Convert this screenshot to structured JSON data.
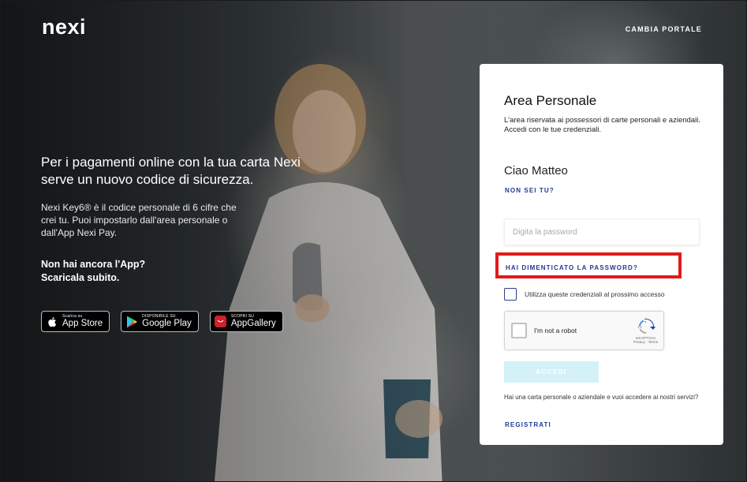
{
  "header": {
    "logo_text": "nexi",
    "change_portal": "CAMBIA PORTALE"
  },
  "hero": {
    "headline": "Per i pagamenti online con la tua carta Nexi serve un nuovo codice di sicurezza.",
    "body": "Nexi Key6® è il codice personale di 6 cifre che crei tu. Puoi impostarlo dall'area personale o dall'App Nexi Pay.",
    "cta_line1": "Non hai ancora l'App?",
    "cta_line2": "Scaricala subito."
  },
  "stores": [
    {
      "small": "Scarica su",
      "big": "App Store",
      "icon": "apple-icon"
    },
    {
      "small": "DISPONIBILE SU",
      "big": "Google Play",
      "icon": "google-play-icon"
    },
    {
      "small": "SCOPRI SU",
      "big": "AppGallery",
      "icon": "huawei-icon"
    }
  ],
  "login": {
    "title": "Area Personale",
    "description": "L'area riservata ai possessori di carte personali e aziendali. Accedi con le tue credenziali.",
    "greeting": "Ciao Matteo",
    "not_you": "NON SEI TU?",
    "password_placeholder": "Digita la password",
    "forgot_password": "HAI DIMENTICATO LA PASSWORD?",
    "remember_label": "Utilizza queste credenziali al prossimo accesso",
    "captcha_label": "I'm not a robot",
    "captcha_brand": "reCAPTCHA",
    "captcha_links": "Privacy - Terms",
    "submit": "ACCEDI",
    "register_prompt": "Hai una carta personale o aziendale e vuoi accedere ai nostri servizi?",
    "register": "REGISTRATI"
  },
  "colors": {
    "accent_link": "#1f3a8f",
    "highlight": "#e31a1a",
    "submit_disabled": "#d4f1f8"
  }
}
